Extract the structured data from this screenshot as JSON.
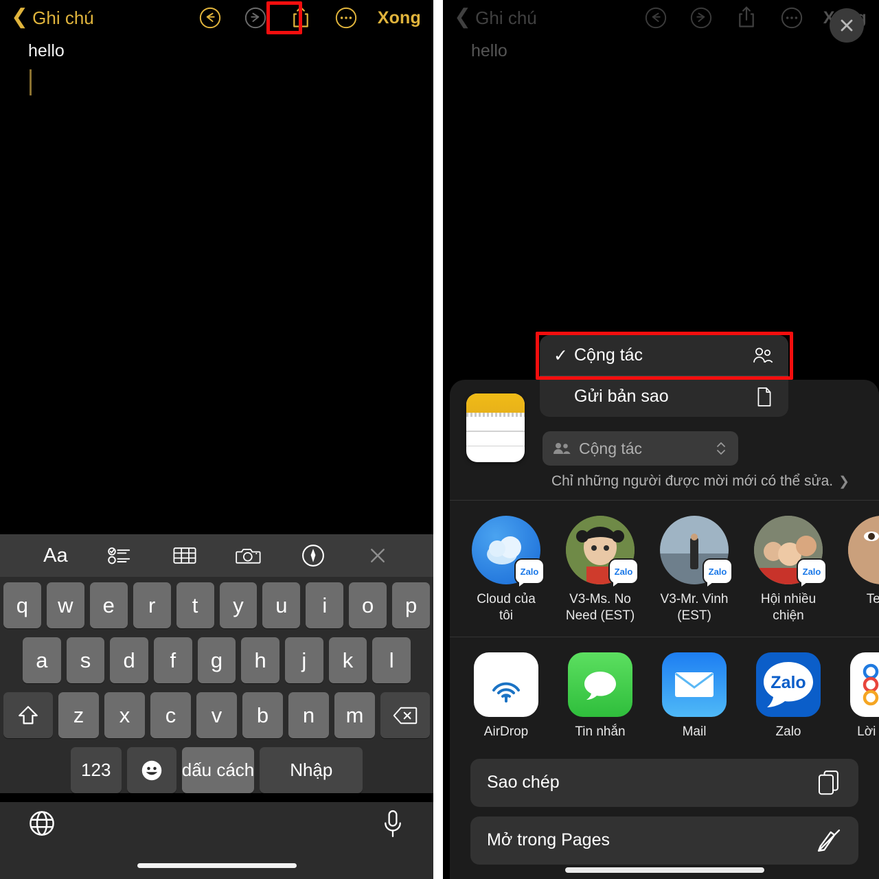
{
  "nav": {
    "back_label": "Ghi chú",
    "done_label": "Xong",
    "undo_icon": "undo-icon",
    "redo_icon": "redo-icon",
    "share_icon": "share-icon",
    "more_icon": "more-options-icon"
  },
  "note": {
    "text": "hello"
  },
  "keyboard": {
    "toolbar_icons": [
      "format-aa-icon",
      "checklist-icon",
      "table-icon",
      "camera-icon",
      "markup-pen-icon",
      "close-icon"
    ],
    "toolbar_aa": "Aa",
    "row1": [
      "q",
      "w",
      "e",
      "r",
      "t",
      "y",
      "u",
      "i",
      "o",
      "p"
    ],
    "row2": [
      "a",
      "s",
      "d",
      "f",
      "g",
      "h",
      "j",
      "k",
      "l"
    ],
    "row3": [
      "z",
      "x",
      "c",
      "v",
      "b",
      "n",
      "m"
    ],
    "shift_icon": "shift-icon",
    "backspace_icon": "backspace-icon",
    "numbers_key": "123",
    "emoji_icon": "emoji-icon",
    "space_key": "dấu cách",
    "enter_key": "Nhập",
    "globe_icon": "globe-icon",
    "mic_icon": "microphone-icon"
  },
  "context_menu": {
    "items": [
      {
        "label": "Cộng tác",
        "checked": true,
        "icon": "people-icon"
      },
      {
        "label": "Gửi bản sao",
        "checked": false,
        "icon": "document-icon"
      }
    ]
  },
  "share_sheet": {
    "collab_pill_label": "Cộng tác",
    "collab_pill_icon": "people-filled-icon",
    "permission_text": "Chỉ những người được mời mới có thể sửa.",
    "permission_chevron": "chevron-right-icon",
    "close_icon": "close-icon",
    "doc_thumb_name": "notes-document-thumbnail",
    "contacts": [
      {
        "name": "Cloud của tôi",
        "badge": "Zalo",
        "avatar": "icloud-logo"
      },
      {
        "name": "V3-Ms. No Need (EST)",
        "badge": "Zalo",
        "avatar": "cartoon-girl-photo"
      },
      {
        "name": "V3-Mr. Vinh (EST)",
        "badge": "Zalo",
        "avatar": "man-outdoors-photo"
      },
      {
        "name": "Hội nhiều chiện",
        "badge": "Zalo",
        "avatar": "group-photo"
      },
      {
        "name": "Team",
        "badge": "",
        "avatar": "face-photo"
      }
    ],
    "apps": [
      {
        "name": "AirDrop",
        "icon": "airdrop-icon"
      },
      {
        "name": "Tin nhắn",
        "icon": "messages-icon"
      },
      {
        "name": "Mail",
        "icon": "mail-icon"
      },
      {
        "name": "Zalo",
        "icon": "zalo-icon"
      },
      {
        "name": "Lời nhắc",
        "icon": "reminders-icon"
      }
    ],
    "actions": [
      {
        "label": "Sao chép",
        "icon": "copy-icon"
      },
      {
        "label": "Mở trong Pages",
        "icon": "pages-icon"
      }
    ]
  },
  "colors": {
    "accent_yellow": "#e0b43c",
    "highlight_red": "#f50e0e",
    "keyboard_bg": "#2c2c2c",
    "key_bg": "#6d6d6d",
    "sheet_bg": "#1c1c1c"
  }
}
